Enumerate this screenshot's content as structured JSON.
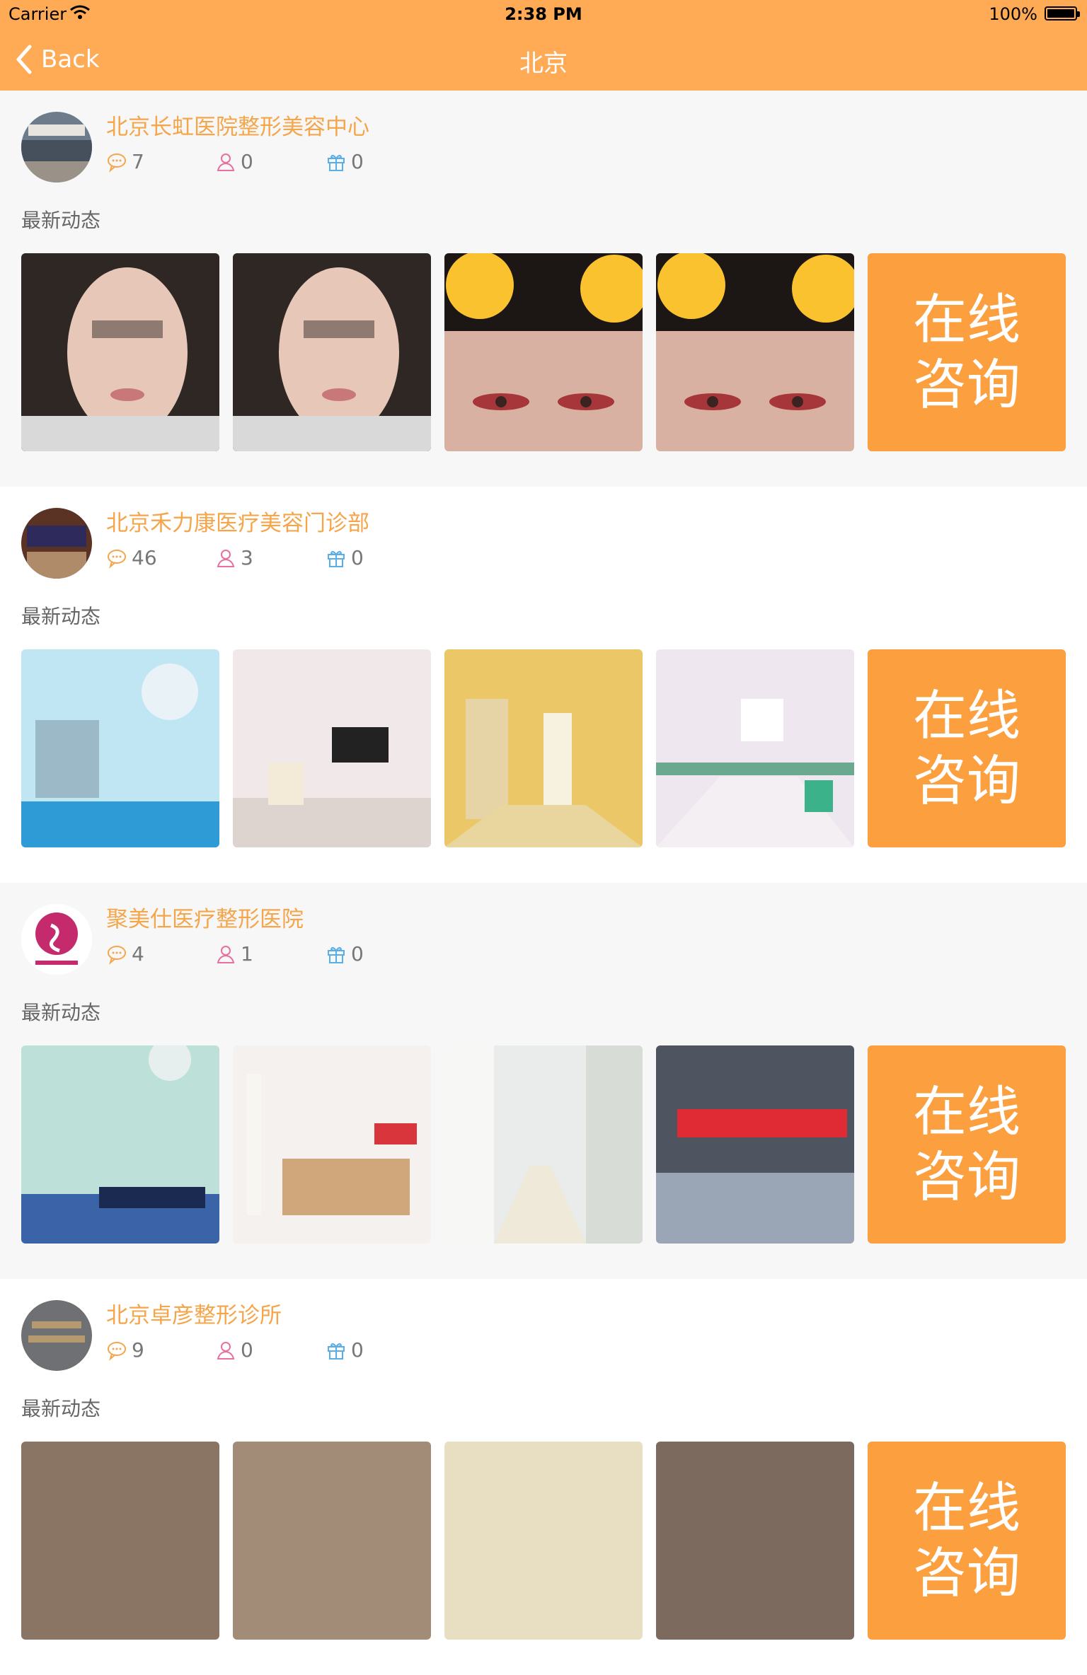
{
  "status_bar": {
    "carrier": "Carrier",
    "time": "2:38 PM",
    "battery": "100%"
  },
  "nav": {
    "back_label": "Back",
    "title": "北京"
  },
  "hospitals": [
    {
      "name": "北京长虹医院整形美容中心",
      "comments": "7",
      "followers": "0",
      "gifts": "0",
      "section_label": "最新动态",
      "photos": [
        "face-photo-1",
        "face-photo-2",
        "eyes-photo-1",
        "eyes-photo-2"
      ],
      "consult_label": "在线\n咨询"
    },
    {
      "name": "北京禾力康医疗美容门诊部",
      "comments": "46",
      "followers": "3",
      "gifts": "0",
      "section_label": "最新动态",
      "photos": [
        "operating-room-photo",
        "waiting-room-photo",
        "hallway-photo",
        "corridor-photo"
      ],
      "consult_label": "在线\n咨询"
    },
    {
      "name": "聚美仕医疗整形医院",
      "comments": "4",
      "followers": "1",
      "gifts": "0",
      "section_label": "最新动态",
      "photos": [
        "treatment-room-photo",
        "reception-photo",
        "white-corridor-photo",
        "building-exterior-photo"
      ],
      "consult_label": "在线\n咨询"
    },
    {
      "name": "北京卓彦整形诊所",
      "comments": "9",
      "followers": "0",
      "gifts": "0",
      "section_label": "最新动态",
      "photos": [
        "photo-1",
        "photo-2",
        "photo-3",
        "photo-4"
      ],
      "consult_label": "在线\n咨询"
    }
  ],
  "colors": {
    "accent": "#ffaa55",
    "name_text": "#f5a54a",
    "consult_bg": "#fb9f3f",
    "comment_icon": "#f5a54a",
    "follower_icon": "#e86fa0",
    "gift_icon": "#5aaee6"
  }
}
